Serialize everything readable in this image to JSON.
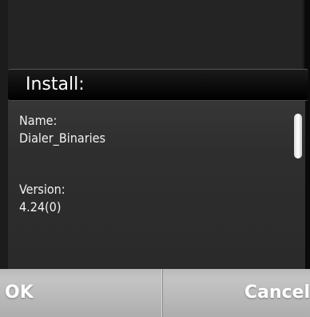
{
  "dialog": {
    "title": "Install:",
    "fields": [
      {
        "label": "Name:",
        "value": "Dialer_Binaries"
      },
      {
        "label": "Version:",
        "value": "4.24(0)"
      }
    ]
  },
  "softkeys": {
    "left": "OK",
    "right": "Cancel"
  },
  "colors": {
    "dialog_background": "#2e2e2e",
    "title_bar": "#000000",
    "softkey_bar": "#b8b8b8",
    "text": "#ffffff"
  }
}
